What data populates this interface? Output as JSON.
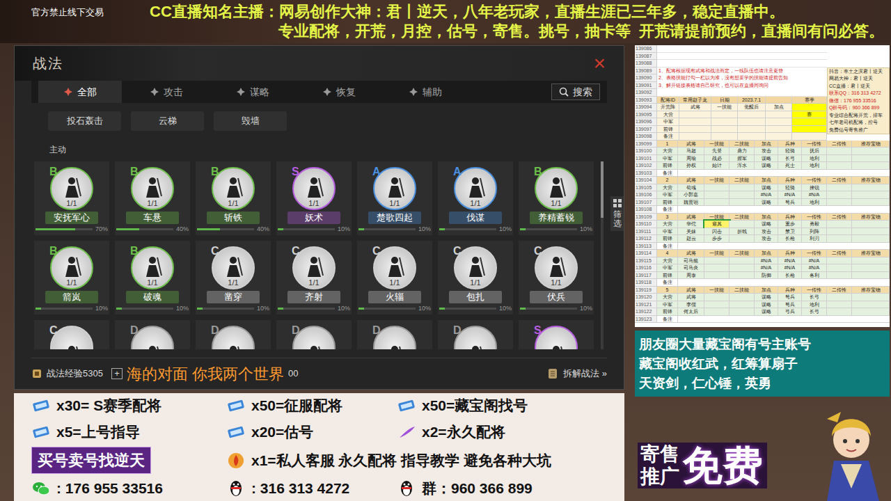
{
  "stream_header": {
    "notice": "官方禁止线下交易",
    "lines": [
      "CC直播知名主播：网易创作大神：君丨逆天，八年老玩家，直播生涯已三年多，稳定直播中。",
      "专业配将，开荒，月控，估号，寄售。挑号，抽卡等  开荒请提前预约，直播间有问必答。"
    ]
  },
  "game_window": {
    "title": "战法",
    "close": "×",
    "tabs": [
      {
        "label": "全部",
        "selected": true
      },
      {
        "label": "攻击",
        "selected": false
      },
      {
        "label": "谋略",
        "selected": false
      },
      {
        "label": "恢复",
        "selected": false
      },
      {
        "label": "辅助",
        "selected": false
      }
    ],
    "search": "搜索",
    "siege_items": [
      "投石轰击",
      "云梯",
      "毁墙"
    ],
    "section": "主动",
    "cards": [
      {
        "grade": "B",
        "count": "1/1",
        "name": "安抚军心",
        "progress": "70%",
        "level": 0.7,
        "color": "#6cc04a"
      },
      {
        "grade": "B",
        "count": "1/1",
        "name": "车悬",
        "progress": "40%",
        "level": 0.4,
        "color": "#6cc04a"
      },
      {
        "grade": "B",
        "count": "1/1",
        "name": "斩铁",
        "progress": "40%",
        "level": 0.4,
        "color": "#6cc04a"
      },
      {
        "grade": "S",
        "count": "1/1",
        "name": "妖术",
        "progress": "10%",
        "level": 0.1,
        "color": "#b65de0"
      },
      {
        "grade": "A",
        "count": "1/1",
        "name": "楚歌四起",
        "progress": "10%",
        "level": 0.1,
        "color": "#4a90e0"
      },
      {
        "grade": "A",
        "count": "1/1",
        "name": "伐谋",
        "progress": "10%",
        "level": 0.1,
        "color": "#4a90e0"
      },
      {
        "grade": "B",
        "count": "1/1",
        "name": "养精蓄锐",
        "progress": "10%",
        "level": 0.1,
        "color": "#6cc04a"
      },
      {
        "grade": "B",
        "count": "1/1",
        "name": "箭岚",
        "progress": "10%",
        "level": 0.1,
        "color": "#6cc04a"
      },
      {
        "grade": "B",
        "count": "1/1",
        "name": "破魂",
        "progress": "10%",
        "level": 0.1,
        "color": "#6cc04a"
      },
      {
        "grade": "C",
        "count": "1/1",
        "name": "凿穿",
        "progress": "10%",
        "level": 0.1,
        "color": "#d0d0d0"
      },
      {
        "grade": "C",
        "count": "1/1",
        "name": "齐射",
        "progress": "10%",
        "level": 0.1,
        "color": "#d0d0d0"
      },
      {
        "grade": "C",
        "count": "1/1",
        "name": "火辎",
        "progress": "10%",
        "level": 0.1,
        "color": "#d0d0d0"
      },
      {
        "grade": "C",
        "count": "1/1",
        "name": "包扎",
        "progress": "10%",
        "level": 0.1,
        "color": "#d0d0d0"
      },
      {
        "grade": "C",
        "count": "1/1",
        "name": "伏兵",
        "progress": "10%",
        "level": 0.1,
        "color": "#d0d0d0"
      }
    ],
    "partial_cards": [
      {
        "grade": "C",
        "color": "#d0d0d0"
      },
      {
        "grade": "D",
        "color": "#9a9a9a"
      },
      {
        "grade": "D",
        "color": "#9a9a9a"
      },
      {
        "grade": "D",
        "color": "#9a9a9a"
      },
      {
        "grade": "D",
        "color": "#9a9a9a"
      },
      {
        "grade": "D",
        "color": "#9a9a9a"
      },
      {
        "grade": "S",
        "color": "#b65de0"
      }
    ],
    "scrollbar_level": 0.3,
    "filter": "筛选",
    "exp": "战法经验5305",
    "add": "+",
    "subtitle": "海的对面 你我两个世界",
    "trailing": "00",
    "dismantle": "拆解战法 »"
  },
  "sheet": {
    "top_rows": [
      {
        "num": "139086",
        "kind": "blank",
        "cells": []
      },
      {
        "num": "139087",
        "kind": "blank",
        "cells": []
      },
      {
        "num": "139088",
        "kind": "blank",
        "cells": []
      },
      {
        "num": "139089",
        "kind": "note",
        "cells": [
          "1、配将根据现有武将和战法而定，一线队伍也请注意更替"
        ]
      },
      {
        "num": "139090",
        "kind": "note",
        "cells": [
          "2、表格技能打勾一栏以为准，没有想要学的技能请提前告知"
        ]
      },
      {
        "num": "139091",
        "kind": "note",
        "cells": [
          "3、解开链接表格请自己研究，也可以在直播间询问"
        ]
      },
      {
        "num": "139092",
        "kind": "blank",
        "cells": []
      },
      {
        "num": "139093",
        "kind": "config",
        "cells": [
          "配将ID",
          "常用赵子龙",
          "日期",
          "2023.7.1",
          "",
          "赛季"
        ]
      },
      {
        "num": "139094",
        "kind": "slot",
        "cells": [
          "开荒阵",
          "武将",
          "一技能",
          "觉醒后",
          "加点",
          {
            "text": "",
            "color": "#ffff00"
          }
        ]
      },
      {
        "num": "139095",
        "kind": "slot",
        "cells": [
          "大营",
          "",
          "",
          "",
          "",
          {
            "text": "赛",
            "color": "#ffff00"
          }
        ]
      },
      {
        "num": "139096",
        "kind": "slot",
        "cells": [
          "中军",
          "",
          "",
          "",
          "",
          {
            "text": "",
            "color": "#ffff00"
          }
        ]
      },
      {
        "num": "139097",
        "kind": "slot",
        "cells": [
          "前锋",
          "",
          "",
          "",
          "",
          {
            "text": "",
            "color": "#ffff00"
          }
        ]
      },
      {
        "num": "139098",
        "kind": "slot",
        "cells": [
          "备注",
          "",
          "",
          "",
          "",
          ""
        ]
      }
    ],
    "info": [
      {
        "text": "抖音：率土之滨君丨逆天",
        "color": "#222222"
      },
      {
        "text": "网易大神：君丨逆天",
        "color": "#222222"
      },
      {
        "text": "CC直播：君丨逆天",
        "color": "#222222"
      },
      {
        "text": "联系QQ：316 313 4272",
        "color": "#d01818"
      },
      {
        "text": "微信：176 955 33516",
        "color": "#d01818"
      },
      {
        "text": "Q群号码：960 366 899",
        "color": "#d01818"
      },
      {
        "text": "专业综合配将开荒，排车",
        "color": "#222222"
      },
      {
        "text": "七年老司机配将，控号",
        "color": "#222222"
      },
      {
        "text": "免费估号寄售推广",
        "color": "#222222"
      }
    ],
    "rows": [
      {
        "num": "139099",
        "kind": "head",
        "cells": [
          "1",
          "武将",
          "一技能",
          "二技能",
          "加点",
          "兵种",
          "一传性",
          "二传性",
          "推荐宝物"
        ]
      },
      {
        "num": "139100",
        "kind": "data",
        "cells": [
          "大营",
          "马超",
          "先登",
          "鼎力",
          "攻击",
          "轻骑",
          "抚后",
          "",
          ""
        ]
      },
      {
        "num": "139101",
        "kind": "data",
        "cells": [
          "中军",
          "周瑜",
          "战必",
          "握军",
          "谋略",
          "长弓",
          "地利",
          "",
          ""
        ]
      },
      {
        "num": "139102",
        "kind": "data",
        "cells": [
          "前锋",
          "孙权",
          "始计",
          "浑水",
          "谋略",
          "死士",
          "地利",
          "",
          ""
        ]
      },
      {
        "num": "139103",
        "kind": "remark",
        "cells": [
          "备注"
        ]
      },
      {
        "num": "139104",
        "kind": "head",
        "cells": [
          "2",
          "武将",
          "一技能",
          "二技能",
          "加点",
          "兵种",
          "一传性",
          "二传性",
          "推荐宝物"
        ]
      },
      {
        "num": "139105",
        "kind": "data",
        "cells": [
          "大营",
          "荀彧",
          "",
          "",
          "谋略",
          "轻骑",
          "挫锐",
          "",
          ""
        ]
      },
      {
        "num": "139106",
        "kind": "data",
        "cells": [
          "中军",
          "小郭嘉",
          "",
          "",
          "#N/A",
          "#N/A",
          "#N/A",
          "",
          ""
        ]
      },
      {
        "num": "139107",
        "kind": "data",
        "cells": [
          "前锋",
          "魏贾诩",
          "",
          "",
          "谋略",
          "弩兵",
          "地利",
          "",
          ""
        ]
      },
      {
        "num": "139108",
        "kind": "remark",
        "cells": [
          "备注"
        ]
      },
      {
        "num": "139109",
        "kind": "head",
        "cells": [
          "3",
          "武将",
          "一技能",
          "二技能",
          "加点",
          "兵种",
          "一传性",
          "二传性",
          "推荐宝物"
        ]
      },
      {
        "num": "139110",
        "kind": "data",
        "cells": [
          "大营",
          "华佗",
          "避其",
          "",
          "谋略",
          "重步",
          "勇毅",
          "",
          ""
        ]
      },
      {
        "num": "139111",
        "kind": "data",
        "cells": [
          "中军",
          "关妹",
          "闪击",
          "折戟",
          "攻击",
          "禁卫",
          "列阵",
          "",
          ""
        ]
      },
      {
        "num": "139112",
        "kind": "data",
        "cells": [
          "前锋",
          "赵云",
          "步步",
          "",
          "攻击",
          "长枪",
          "利刃",
          "",
          ""
        ]
      },
      {
        "num": "139113",
        "kind": "remark",
        "cells": [
          "备注"
        ]
      },
      {
        "num": "139114",
        "kind": "head",
        "cells": [
          "4",
          "武将",
          "一技能",
          "二技能",
          "加点",
          "兵种",
          "一传性",
          "二传性",
          "推荐宝物"
        ]
      },
      {
        "num": "139115",
        "kind": "data",
        "cells": [
          "大营",
          "司马懿",
          "",
          "",
          "#N/A",
          "#N/A",
          "#N/A",
          "",
          ""
        ]
      },
      {
        "num": "139116",
        "kind": "data",
        "cells": [
          "中军",
          "司马炎",
          "",
          "",
          "#N/A",
          "#N/A",
          "#N/A",
          "",
          ""
        ]
      },
      {
        "num": "139117",
        "kind": "data",
        "cells": [
          "前锋",
          "周泰",
          "",
          "",
          "防御",
          "长枪",
          "各利",
          "",
          ""
        ]
      },
      {
        "num": "139118",
        "kind": "remark",
        "cells": [
          "备注"
        ]
      },
      {
        "num": "139119",
        "kind": "head",
        "cells": [
          "5",
          "武将",
          "一技能",
          "二技能",
          "加点",
          "兵种",
          "一传性",
          "二传性",
          "推荐宝物"
        ]
      },
      {
        "num": "139120",
        "kind": "data",
        "cells": [
          "大营",
          "武将",
          "",
          "",
          "谋略",
          "弩兵",
          "长弓",
          "",
          ""
        ]
      },
      {
        "num": "139121",
        "kind": "data",
        "cells": [
          "中军",
          "李儒",
          "",
          "",
          "谋略",
          "弩兵",
          "地利",
          "",
          ""
        ]
      },
      {
        "num": "139122",
        "kind": "data",
        "cells": [
          "前锋",
          "何太后",
          "",
          "",
          "谋略",
          "弓兵",
          "长弓",
          "",
          ""
        ]
      },
      {
        "num": "139123",
        "kind": "remark",
        "cells": [
          "备注"
        ]
      }
    ],
    "selected_cell": {
      "row": "139110",
      "col": 2
    }
  },
  "promo": {
    "lines": [
      "朋友圈大量藏宝阁有号主账号",
      "藏宝阁收红武，红筹算扇子",
      "天资剑，仁心锤，英勇"
    ]
  },
  "consign": {
    "small": [
      "寄售",
      "推广"
    ],
    "big": "免费"
  },
  "price_list": {
    "rows": [
      [
        {
          "kind": "ticket",
          "text": "x30= S赛季配将"
        },
        {
          "kind": "ticket",
          "text": "x50=征服配将"
        },
        {
          "kind": "ticket",
          "text": "x50=藏宝阁找号"
        }
      ],
      [
        {
          "kind": "ticket",
          "text": "x5=上号指导"
        },
        {
          "kind": "ticket",
          "text": "x20=估号"
        },
        {
          "kind": "feather",
          "text": "x2=永久配将"
        }
      ],
      [
        {
          "kind": "banner",
          "text": "买号卖号找逆天"
        },
        {
          "kind": "fire",
          "text": "x1=私人客服 永久配将 指导教学 避免各种大坑"
        }
      ],
      [
        {
          "kind": "wechat",
          "text": ": 176 955 33516"
        },
        {
          "kind": "qq",
          "text": ": 316 313 4272"
        },
        {
          "kind": "qq",
          "text": "群：960 366 899"
        }
      ]
    ]
  }
}
